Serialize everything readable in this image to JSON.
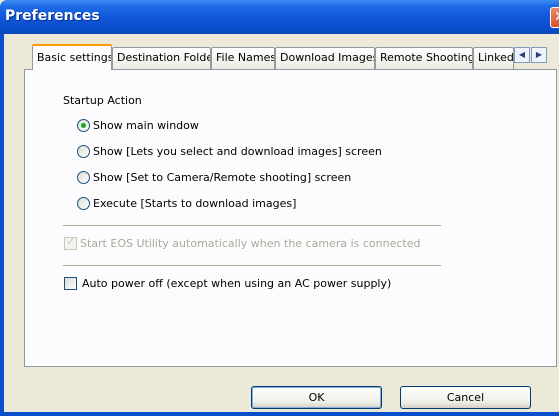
{
  "window": {
    "title": "Preferences"
  },
  "tabs": [
    {
      "label": "Basic settings",
      "active": true
    },
    {
      "label": "Destination Folder"
    },
    {
      "label": "File Names"
    },
    {
      "label": "Download Images"
    },
    {
      "label": "Remote Shooting"
    },
    {
      "label": "Linked"
    }
  ],
  "tab_scroll": {
    "left_icon": "arrow-left-icon",
    "right_icon": "arrow-right-icon",
    "left_glyph": "◀",
    "right_glyph": "▶"
  },
  "startup": {
    "heading": "Startup Action",
    "selected_index": 0,
    "options": [
      "Show main window",
      "Show [Lets you select and download images] screen",
      "Show [Set to Camera/Remote shooting] screen",
      "Execute [Starts to download images]"
    ]
  },
  "auto_start": {
    "label": "Start EOS Utility automatically when the camera is connected",
    "checked": true,
    "enabled": false
  },
  "auto_power_off": {
    "label": "Auto power off (except when using an AC power supply)",
    "checked": false
  },
  "buttons": {
    "ok": "OK",
    "cancel": "Cancel"
  },
  "colors": {
    "titlebar": "#0a4ec9",
    "dialog_bg": "#ece9d8",
    "active_tab_accent": "#ff9d00",
    "radio_selected": "#21a121"
  }
}
